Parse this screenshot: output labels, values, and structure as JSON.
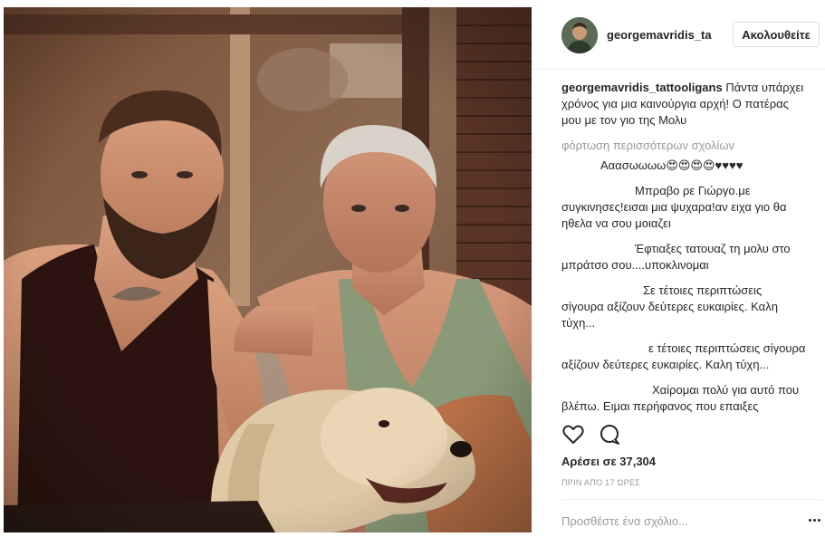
{
  "post": {
    "image_alt": "Two men and a golden retriever sitting together",
    "username": "georgemavridis_ta",
    "follow_label": "Ακολουθείτε",
    "caption_user": "georgemavridis_tattooligans",
    "caption_text": "Πάντα υπάρχει χρόνος για μια καινούργια αρχή! Ο πατέρας μου με τον γιο της Μολυ",
    "load_more": "φόρτωση περισσότερων σχολίων",
    "comments": [
      {
        "text": "Ααασωωωω😍😍😍😍♥♥♥♥"
      },
      {
        "text": "Μπραβο ρε Γιώργο.με συγκινησες!εισαι μια ψυχαρα!αν ειχα γιο θα ηθελα να σου μοιαζει"
      },
      {
        "text": "Έφτιαξες τατουαζ τη μολυ στο μπράτσο σου....υποκλινομαι"
      },
      {
        "text": "Σε τέτοιες περιπτώσεις σίγουρα αξίζουν δεύτερες ευκαιρίες. Καλη τύχη..."
      },
      {
        "text": "ε τέτοιες περιπτώσεις σίγουρα αξίζουν δεύτερες ευκαιρίες. Καλη τύχη..."
      },
      {
        "text": "Χαίρομαι πολύ για αυτό που βλέπω. Ειμαι περήφανος που επαιξες"
      }
    ],
    "likes": "Αρέσει σε 37,304",
    "time": "ΠΡΙΝ ΑΠΌ 17 ΏΡΕΣ",
    "comment_placeholder": "Προσθέστε ένα σχόλιο...",
    "icons": {
      "like": "heart-icon",
      "comment": "comment-icon",
      "more": "more-options-icon"
    }
  }
}
